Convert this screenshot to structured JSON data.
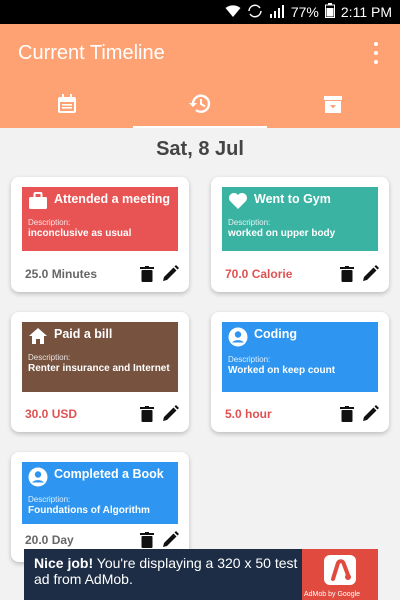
{
  "status_bar": {
    "battery": "77%",
    "time": "2:11 PM"
  },
  "app_bar": {
    "title": "Current Timeline"
  },
  "tabs": [
    {
      "icon": "calendar-icon"
    },
    {
      "icon": "history-icon",
      "active": true
    },
    {
      "icon": "archive-icon"
    }
  ],
  "date": "Sat, 8 Jul",
  "cards": [
    {
      "title": "Attended a meeting",
      "desc_label": "Description:",
      "description": "inconclusive as usual",
      "metric": "25.0 Minutes",
      "icon": "briefcase-icon",
      "color": "#e85353"
    },
    {
      "title": "Went to Gym",
      "desc_label": "Description:",
      "description": "worked on upper body",
      "metric": "70.0 Calorie",
      "icon": "heart-icon",
      "color": "#3bb3a3"
    },
    {
      "title": "Paid a bill",
      "desc_label": "Description:",
      "description": "Renter insurance and Internet",
      "metric": "30.0 USD",
      "icon": "home-icon",
      "color": "#76523f"
    },
    {
      "title": "Coding",
      "desc_label": "Description:",
      "description": "Worked on keep count",
      "metric": "5.0 hour",
      "icon": "account-icon",
      "color": "#2e96f0"
    },
    {
      "title": "Completed a Book",
      "desc_label": "Description:",
      "description": "Foundations of Algorithm",
      "metric": "20.0 Day",
      "icon": "account-icon",
      "color": "#2e96f0"
    }
  ],
  "ad": {
    "bold": "Nice job!",
    "text": " You're displaying a 320 x 50 test ad from AdMob.",
    "caption": "AdMob by Google"
  }
}
